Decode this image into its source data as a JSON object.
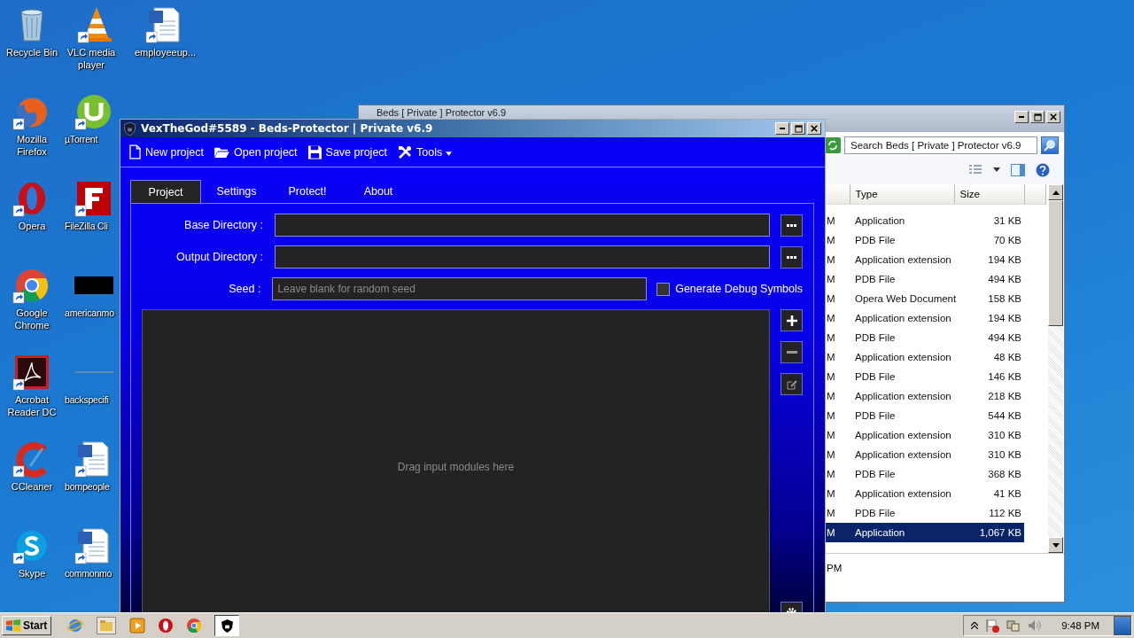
{
  "desktop": {
    "icons": [
      {
        "label": "Recycle Bin",
        "kind": "recycle"
      },
      {
        "label": "Mozilla Firefox",
        "kind": "firefox"
      },
      {
        "label": "Opera",
        "kind": "opera"
      },
      {
        "label": "Google Chrome",
        "kind": "chrome"
      },
      {
        "label": "Acrobat Reader DC",
        "kind": "acrobat"
      },
      {
        "label": "CCleaner",
        "kind": "ccleaner"
      },
      {
        "label": "Skype",
        "kind": "skype"
      },
      {
        "label": "VLC media player",
        "kind": "vlc"
      },
      {
        "label": "µTorrent",
        "kind": "utorrent"
      },
      {
        "label": "FileZilla Cli",
        "kind": "filezilla"
      },
      {
        "label": "americanmo",
        "kind": "blackbar"
      },
      {
        "label": "backspecifi",
        "kind": "blank"
      },
      {
        "label": "bornpeople",
        "kind": "word"
      },
      {
        "label": "commonmo",
        "kind": "word"
      },
      {
        "label": "employeeup...",
        "kind": "word"
      }
    ]
  },
  "explorer": {
    "title": "Beds [ Private ] Protector v6.9",
    "search": {
      "placeholder": "Search Beds [ Private ] Protector v6.9"
    },
    "columns": [
      "Type",
      "Size"
    ],
    "rows": [
      {
        "date": "M",
        "type": "Application",
        "size": "31 KB",
        "selected": false
      },
      {
        "date": "M",
        "type": "PDB File",
        "size": "70 KB",
        "selected": false
      },
      {
        "date": "M",
        "type": "Application extension",
        "size": "194 KB",
        "selected": false
      },
      {
        "date": "M",
        "type": "PDB File",
        "size": "494 KB",
        "selected": false
      },
      {
        "date": "M",
        "type": "Opera Web Document",
        "size": "158 KB",
        "selected": false
      },
      {
        "date": "M",
        "type": "Application extension",
        "size": "194 KB",
        "selected": false
      },
      {
        "date": "M",
        "type": "PDB File",
        "size": "494 KB",
        "selected": false
      },
      {
        "date": "M",
        "type": "Application extension",
        "size": "48 KB",
        "selected": false
      },
      {
        "date": "M",
        "type": "PDB File",
        "size": "146 KB",
        "selected": false
      },
      {
        "date": "M",
        "type": "Application extension",
        "size": "218 KB",
        "selected": false
      },
      {
        "date": "M",
        "type": "PDB File",
        "size": "544 KB",
        "selected": false
      },
      {
        "date": "M",
        "type": "Application extension",
        "size": "310 KB",
        "selected": false
      },
      {
        "date": "M",
        "type": "Application extension",
        "size": "310 KB",
        "selected": false
      },
      {
        "date": "M",
        "type": "PDB File",
        "size": "368 KB",
        "selected": false
      },
      {
        "date": "M",
        "type": "Application extension",
        "size": "41 KB",
        "selected": false
      },
      {
        "date": "M",
        "type": "PDB File",
        "size": "112 KB",
        "selected": false
      },
      {
        "date": "M",
        "type": "Application",
        "size": "1,067 KB",
        "selected": true
      }
    ],
    "details": "PM"
  },
  "app": {
    "title": "VexTheGod#5589 - Beds-Protector | Private v6.9",
    "toolbar": [
      {
        "label": "New project",
        "kind": "new"
      },
      {
        "label": "Open project",
        "kind": "open"
      },
      {
        "label": "Save project",
        "kind": "save"
      },
      {
        "label": "Tools",
        "kind": "tools"
      }
    ],
    "tabs": [
      {
        "label": "Project",
        "selected": true
      },
      {
        "label": "Settings",
        "selected": false
      },
      {
        "label": "Protect!",
        "selected": false
      },
      {
        "label": "About",
        "selected": false
      }
    ],
    "base_directory": {
      "label": "Base Directory :"
    },
    "output_directory": {
      "label": "Output Directory :"
    },
    "seed": {
      "label": "Seed :",
      "placeholder": "Leave blank for random seed"
    },
    "debug_symbols": {
      "label": "Generate Debug Symbols",
      "checked": false
    },
    "modules": {
      "placeholder": "Drag input modules here"
    }
  },
  "taskbar": {
    "start": "Start",
    "clock": "9:48 PM"
  }
}
